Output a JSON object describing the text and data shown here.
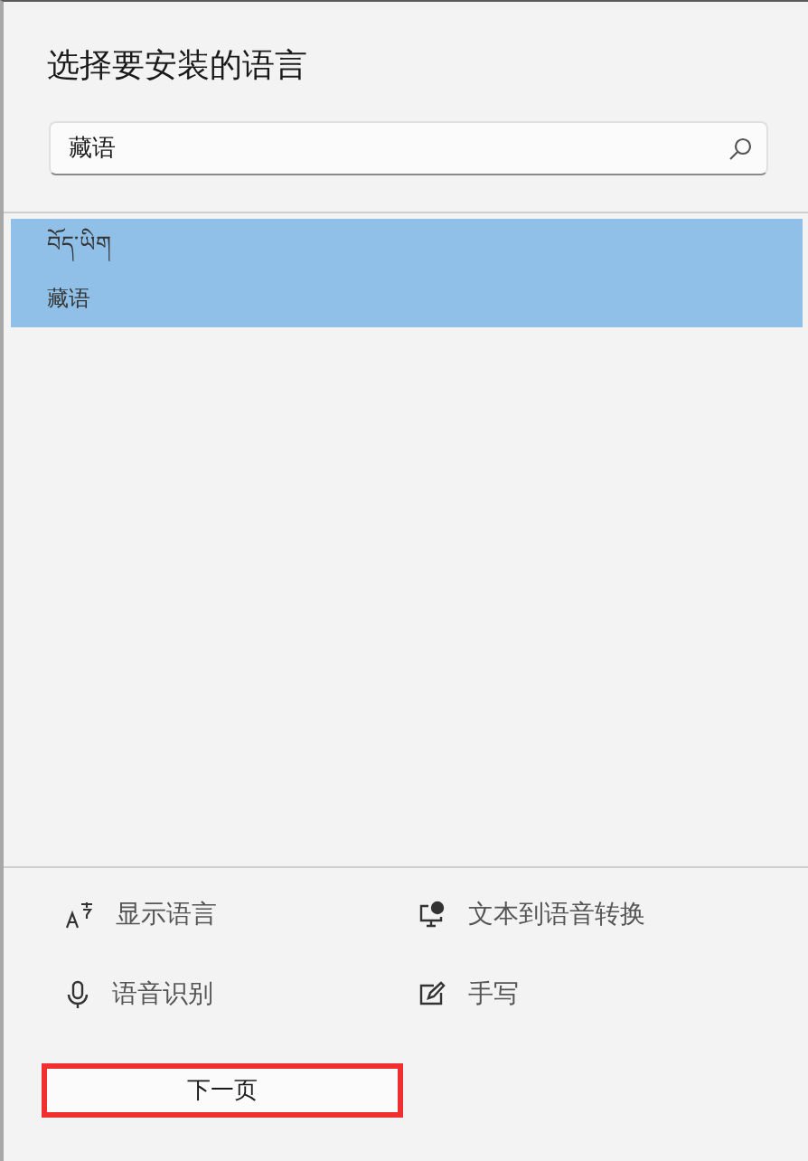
{
  "title": "选择要安装的语言",
  "search": {
    "value": "藏语"
  },
  "languages": [
    {
      "native_name": "བོད་ཡིག",
      "name": "藏语",
      "selected": true
    }
  ],
  "features": [
    {
      "kind": "display",
      "label": "显示语言"
    },
    {
      "kind": "tts",
      "label": "文本到语音转换"
    },
    {
      "kind": "speech",
      "label": "语音识别"
    },
    {
      "kind": "handwriting",
      "label": "手写"
    }
  ],
  "next_button": {
    "label": "下一页",
    "highlighted": true
  }
}
